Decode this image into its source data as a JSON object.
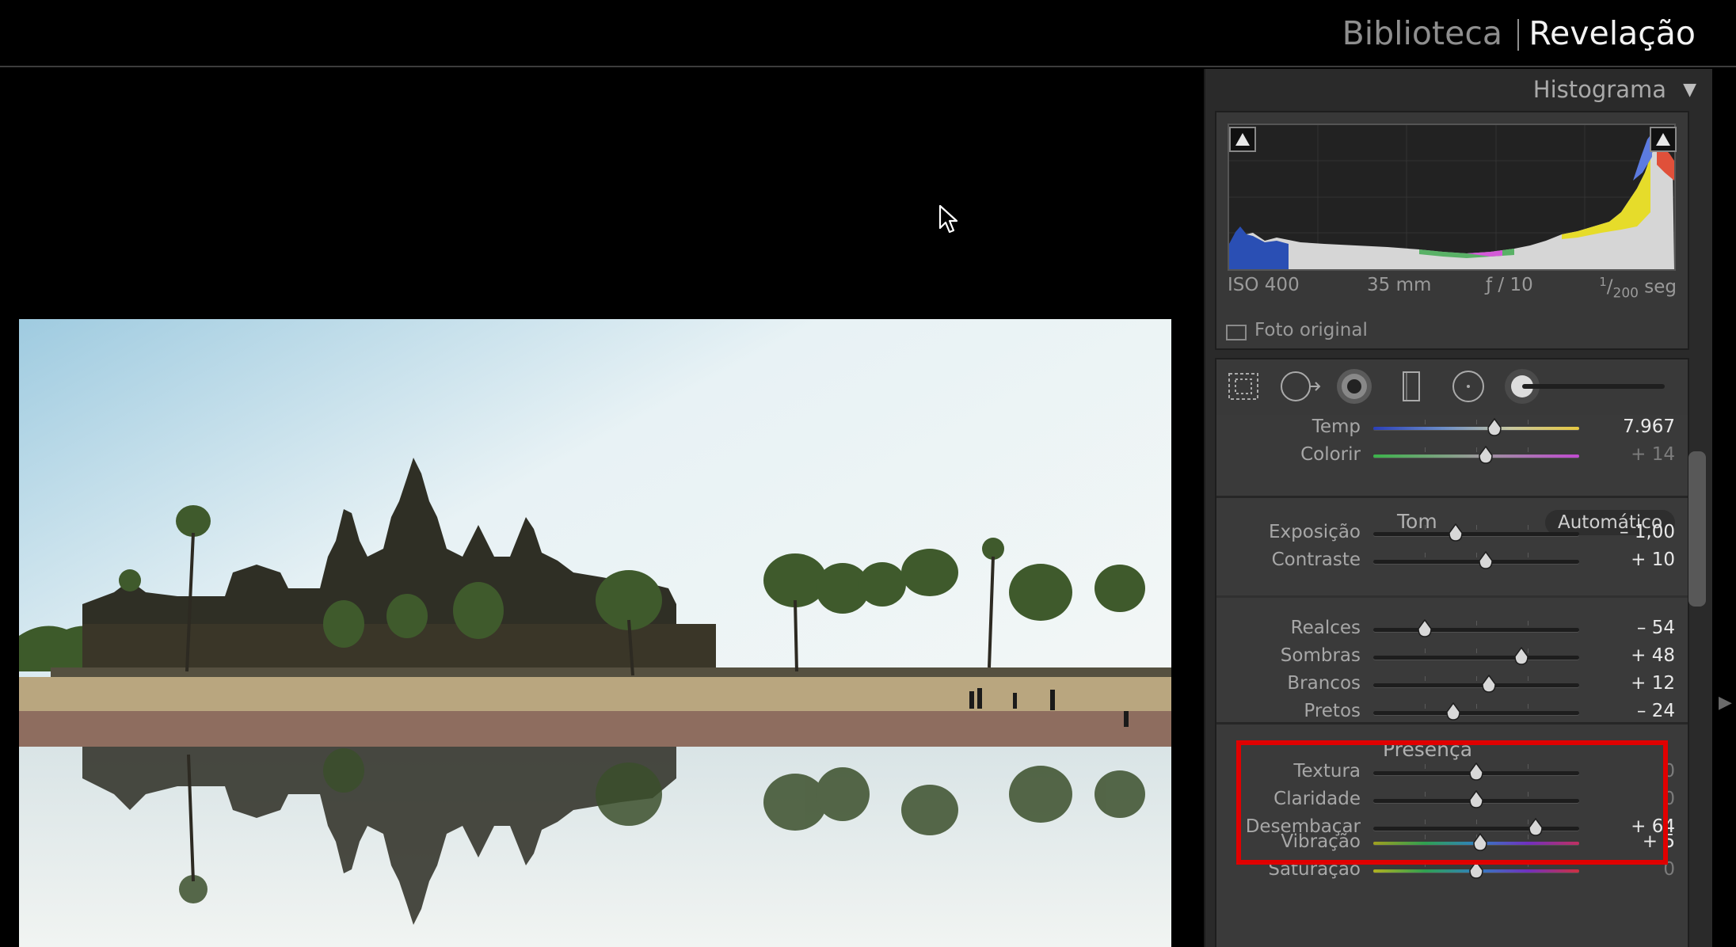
{
  "modules": {
    "library": "Biblioteca",
    "develop": "Revelação"
  },
  "histogram": {
    "title": "Histograma",
    "toggle_icon": "triangle-down-icon",
    "iso": "ISO 400",
    "focal_length": "35 mm",
    "aperture": "ƒ / 10",
    "shutter_num": "1",
    "shutter_den": "200",
    "shutter_unit": "seg",
    "original_photo_label": "Foto original"
  },
  "tools": [
    "crop-overlay-icon",
    "spot-removal-icon",
    "red-eye-icon",
    "graduated-filter-icon",
    "radial-filter-icon",
    "adjustment-brush-icon"
  ],
  "white_balance": [
    {
      "label": "Temp",
      "value": "7.967",
      "position": 0.59,
      "track": "temp",
      "dim": false
    },
    {
      "label": "Colorir",
      "value": "+ 14",
      "position": 0.545,
      "track": "tint",
      "dim": true
    }
  ],
  "tone": {
    "title": "Tom",
    "auto_label": "Automático",
    "basic": [
      {
        "label": "Exposição",
        "value": "– 1,00",
        "position": 0.4,
        "dim": false
      },
      {
        "label": "Contraste",
        "value": "+ 10",
        "position": 0.545,
        "dim": false
      }
    ],
    "detail": [
      {
        "label": "Realces",
        "value": "– 54",
        "position": 0.25,
        "dim": false
      },
      {
        "label": "Sombras",
        "value": "+ 48",
        "position": 0.72,
        "dim": false
      },
      {
        "label": "Brancos",
        "value": "+ 12",
        "position": 0.56,
        "dim": false
      },
      {
        "label": "Pretos",
        "value": "– 24",
        "position": 0.39,
        "dim": false
      }
    ]
  },
  "presence": {
    "title": "Presença",
    "items": [
      {
        "label": "Textura",
        "value": "0",
        "position": 0.5,
        "dim": true
      },
      {
        "label": "Claridade",
        "value": "0",
        "position": 0.5,
        "dim": true
      },
      {
        "label": "Desembaçar",
        "value": "+ 64",
        "position": 0.79,
        "dim": false
      }
    ],
    "color_items": [
      {
        "label": "Vibração",
        "value": "+ 5",
        "position": 0.52,
        "track": "vibrance",
        "dim": false
      },
      {
        "label": "Saturação",
        "value": "0",
        "position": 0.5,
        "track": "saturation",
        "dim": true
      }
    ]
  },
  "colors": {
    "background": "#000000",
    "panel": "#3a3a3a",
    "highlight_box": "#e00000",
    "active_module": "#f3f3f3",
    "inactive_module": "#8e8e8e"
  }
}
